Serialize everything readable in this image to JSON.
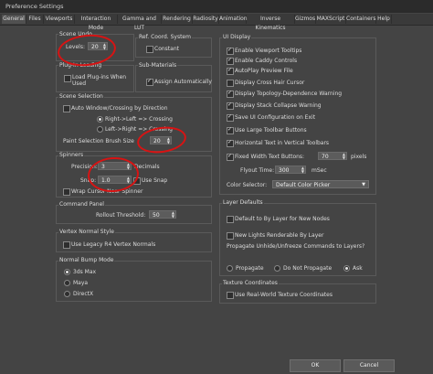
{
  "window": {
    "title": "Preference Settings"
  },
  "tabs": [
    "General",
    "Files",
    "Viewports",
    "Interaction Mode",
    "Gamma and LUT",
    "Rendering",
    "Radiosity",
    "Animation",
    "Inverse Kinematics",
    "Gizmos",
    "MAXScript",
    "Containers",
    "Help"
  ],
  "scene_undo": {
    "title": "Scene Undo",
    "levels_label": "Levels:",
    "levels_value": "20"
  },
  "ref_coord": {
    "title": "Ref. Coord. System",
    "constant": "Constant"
  },
  "plugin_loading": {
    "title": "Plug-In Loading",
    "load_when_used": "Load Plug-ins When Used"
  },
  "sub_materials": {
    "title": "Sub-Materials",
    "assign_auto": "Assign Automatically"
  },
  "scene_selection": {
    "title": "Scene Selection",
    "auto_window": "Auto Window/Crossing by Direction",
    "right_left": "Right->Left => Crossing",
    "left_right": "Left->Right => Crossing",
    "brush_size_label": "Paint Selection Brush Size",
    "brush_size_value": "20"
  },
  "spinners": {
    "title": "Spinners",
    "precision_label": "Precision:",
    "precision_value": "3",
    "decimals": "Decimals",
    "snap_label": "Snap:",
    "snap_value": "1.0",
    "use_snap": "Use Snap",
    "wrap_cursor": "Wrap Cursor Near Spinner"
  },
  "command_panel": {
    "title": "Command Panel",
    "rollout_label": "Rollout Threshold:",
    "rollout_value": "50"
  },
  "vertex_normal": {
    "title": "Vertex Normal Style",
    "use_legacy": "Use Legacy R4 Vertex Normals"
  },
  "normal_bump": {
    "title": "Normal Bump Mode",
    "options": [
      "3ds Max",
      "Maya",
      "DirectX"
    ]
  },
  "ui_display": {
    "title": "UI Display",
    "items": [
      "Enable Viewport Tooltips",
      "Enable Caddy Controls",
      "AutoPlay Preview File",
      "Display Cross Hair Cursor",
      "Display Topology-Dependence Warning",
      "Display Stack Collapse Warning",
      "Save UI Configuration on Exit",
      "Use Large Toolbar Buttons",
      "Horizontal Text in Vertical Toolbars",
      "Fixed Width Text Buttons:"
    ],
    "fixed_width_value": "70",
    "pixels": "pixels",
    "flyout_label": "Flyout Time:",
    "flyout_value": "300",
    "msec": "mSec",
    "color_selector_label": "Color Selector:",
    "color_selector_value": "Default Color Picker"
  },
  "layer_defaults": {
    "title": "Layer Defaults",
    "default_by_layer": "Default to By Layer for New Nodes",
    "new_lights": "New Lights Renderable By Layer",
    "propagate_label": "Propagate Unhide/Unfreeze Commands to Layers?",
    "propagate": "Propagate",
    "do_not_propagate": "Do Not Propagate",
    "ask": "Ask"
  },
  "texture_coords": {
    "title": "Texture Coordinates",
    "real_world": "Use Real-World Texture Coordinates"
  },
  "footer": {
    "ok": "OK",
    "cancel": "Cancel"
  }
}
